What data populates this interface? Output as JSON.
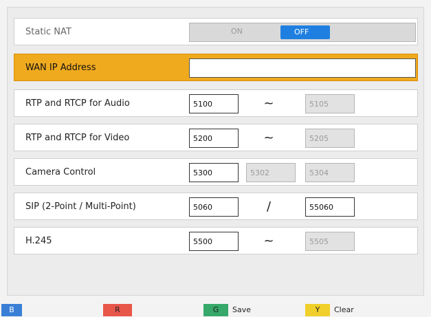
{
  "rows": {
    "static_nat": {
      "label": "Static NAT",
      "on_label": "ON",
      "off_label": "OFF",
      "selected": "OFF"
    },
    "wan_ip": {
      "label": "WAN IP Address",
      "value": ""
    },
    "rtp_audio": {
      "label": "RTP and RTCP for Audio",
      "start": "5100",
      "sep": "~",
      "end": "5105"
    },
    "rtp_video": {
      "label": "RTP and RTCP for Video",
      "start": "5200",
      "sep": "~",
      "end": "5205"
    },
    "camera": {
      "label": "Camera Control",
      "v1": "5300",
      "v2": "5302",
      "v3": "5304"
    },
    "sip": {
      "label": "SIP (2-Point / Multi-Point)",
      "start": "5060",
      "sep": "/",
      "end": "55060"
    },
    "h245": {
      "label": "H.245",
      "start": "5500",
      "sep": "~",
      "end": "5505"
    }
  },
  "footer": {
    "b": {
      "key": "B",
      "label": "",
      "color": "#3a7fd6"
    },
    "r": {
      "key": "R",
      "label": "",
      "color": "#e8564a"
    },
    "g": {
      "key": "G",
      "label": "Save",
      "color": "#35a86a"
    },
    "y": {
      "key": "Y",
      "label": "Clear",
      "color": "#f1cf2a"
    }
  },
  "colors": {
    "highlight": "#f0aa1e",
    "toggle_on": "#1f7fe0"
  }
}
